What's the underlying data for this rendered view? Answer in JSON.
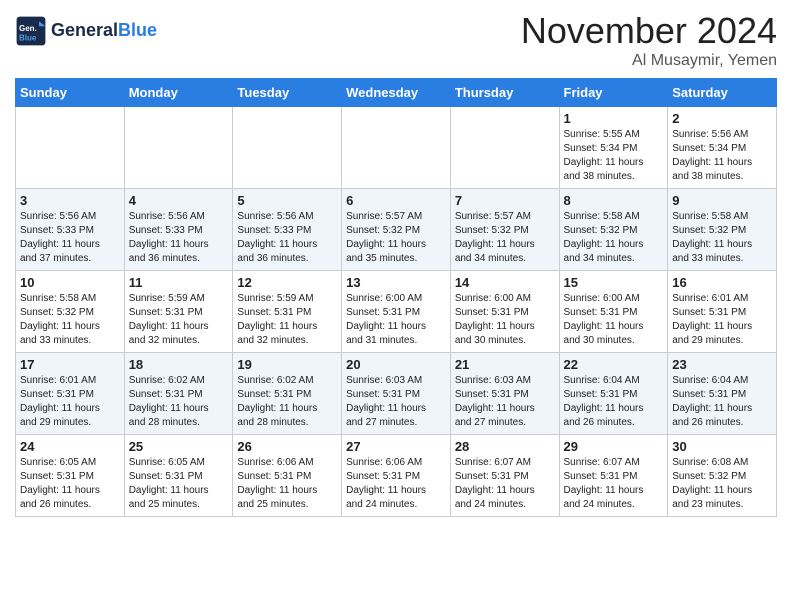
{
  "header": {
    "logo_line1": "General",
    "logo_line2": "Blue",
    "month": "November 2024",
    "location": "Al Musaymir, Yemen"
  },
  "days_of_week": [
    "Sunday",
    "Monday",
    "Tuesday",
    "Wednesday",
    "Thursday",
    "Friday",
    "Saturday"
  ],
  "weeks": [
    [
      {
        "day": "",
        "info": ""
      },
      {
        "day": "",
        "info": ""
      },
      {
        "day": "",
        "info": ""
      },
      {
        "day": "",
        "info": ""
      },
      {
        "day": "",
        "info": ""
      },
      {
        "day": "1",
        "info": "Sunrise: 5:55 AM\nSunset: 5:34 PM\nDaylight: 11 hours\nand 38 minutes."
      },
      {
        "day": "2",
        "info": "Sunrise: 5:56 AM\nSunset: 5:34 PM\nDaylight: 11 hours\nand 38 minutes."
      }
    ],
    [
      {
        "day": "3",
        "info": "Sunrise: 5:56 AM\nSunset: 5:33 PM\nDaylight: 11 hours\nand 37 minutes."
      },
      {
        "day": "4",
        "info": "Sunrise: 5:56 AM\nSunset: 5:33 PM\nDaylight: 11 hours\nand 36 minutes."
      },
      {
        "day": "5",
        "info": "Sunrise: 5:56 AM\nSunset: 5:33 PM\nDaylight: 11 hours\nand 36 minutes."
      },
      {
        "day": "6",
        "info": "Sunrise: 5:57 AM\nSunset: 5:32 PM\nDaylight: 11 hours\nand 35 minutes."
      },
      {
        "day": "7",
        "info": "Sunrise: 5:57 AM\nSunset: 5:32 PM\nDaylight: 11 hours\nand 34 minutes."
      },
      {
        "day": "8",
        "info": "Sunrise: 5:58 AM\nSunset: 5:32 PM\nDaylight: 11 hours\nand 34 minutes."
      },
      {
        "day": "9",
        "info": "Sunrise: 5:58 AM\nSunset: 5:32 PM\nDaylight: 11 hours\nand 33 minutes."
      }
    ],
    [
      {
        "day": "10",
        "info": "Sunrise: 5:58 AM\nSunset: 5:32 PM\nDaylight: 11 hours\nand 33 minutes."
      },
      {
        "day": "11",
        "info": "Sunrise: 5:59 AM\nSunset: 5:31 PM\nDaylight: 11 hours\nand 32 minutes."
      },
      {
        "day": "12",
        "info": "Sunrise: 5:59 AM\nSunset: 5:31 PM\nDaylight: 11 hours\nand 32 minutes."
      },
      {
        "day": "13",
        "info": "Sunrise: 6:00 AM\nSunset: 5:31 PM\nDaylight: 11 hours\nand 31 minutes."
      },
      {
        "day": "14",
        "info": "Sunrise: 6:00 AM\nSunset: 5:31 PM\nDaylight: 11 hours\nand 30 minutes."
      },
      {
        "day": "15",
        "info": "Sunrise: 6:00 AM\nSunset: 5:31 PM\nDaylight: 11 hours\nand 30 minutes."
      },
      {
        "day": "16",
        "info": "Sunrise: 6:01 AM\nSunset: 5:31 PM\nDaylight: 11 hours\nand 29 minutes."
      }
    ],
    [
      {
        "day": "17",
        "info": "Sunrise: 6:01 AM\nSunset: 5:31 PM\nDaylight: 11 hours\nand 29 minutes."
      },
      {
        "day": "18",
        "info": "Sunrise: 6:02 AM\nSunset: 5:31 PM\nDaylight: 11 hours\nand 28 minutes."
      },
      {
        "day": "19",
        "info": "Sunrise: 6:02 AM\nSunset: 5:31 PM\nDaylight: 11 hours\nand 28 minutes."
      },
      {
        "day": "20",
        "info": "Sunrise: 6:03 AM\nSunset: 5:31 PM\nDaylight: 11 hours\nand 27 minutes."
      },
      {
        "day": "21",
        "info": "Sunrise: 6:03 AM\nSunset: 5:31 PM\nDaylight: 11 hours\nand 27 minutes."
      },
      {
        "day": "22",
        "info": "Sunrise: 6:04 AM\nSunset: 5:31 PM\nDaylight: 11 hours\nand 26 minutes."
      },
      {
        "day": "23",
        "info": "Sunrise: 6:04 AM\nSunset: 5:31 PM\nDaylight: 11 hours\nand 26 minutes."
      }
    ],
    [
      {
        "day": "24",
        "info": "Sunrise: 6:05 AM\nSunset: 5:31 PM\nDaylight: 11 hours\nand 26 minutes."
      },
      {
        "day": "25",
        "info": "Sunrise: 6:05 AM\nSunset: 5:31 PM\nDaylight: 11 hours\nand 25 minutes."
      },
      {
        "day": "26",
        "info": "Sunrise: 6:06 AM\nSunset: 5:31 PM\nDaylight: 11 hours\nand 25 minutes."
      },
      {
        "day": "27",
        "info": "Sunrise: 6:06 AM\nSunset: 5:31 PM\nDaylight: 11 hours\nand 24 minutes."
      },
      {
        "day": "28",
        "info": "Sunrise: 6:07 AM\nSunset: 5:31 PM\nDaylight: 11 hours\nand 24 minutes."
      },
      {
        "day": "29",
        "info": "Sunrise: 6:07 AM\nSunset: 5:31 PM\nDaylight: 11 hours\nand 24 minutes."
      },
      {
        "day": "30",
        "info": "Sunrise: 6:08 AM\nSunset: 5:32 PM\nDaylight: 11 hours\nand 23 minutes."
      }
    ]
  ]
}
